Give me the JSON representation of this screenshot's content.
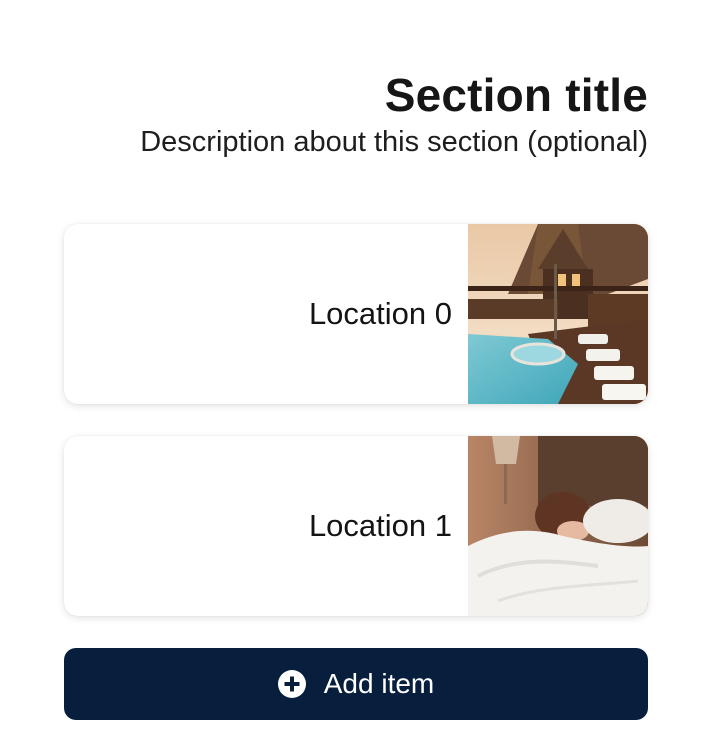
{
  "section": {
    "title": "Section title",
    "description": "Description about this section (optional)"
  },
  "items": [
    {
      "label": "Location 0",
      "image": "resort-pool-photo"
    },
    {
      "label": "Location 1",
      "image": "woman-in-bed-photo"
    }
  ],
  "add_button": {
    "label": "Add item",
    "icon": "plus-circle-icon"
  },
  "colors": {
    "button_background": "#071f3d",
    "button_text": "#ffffff"
  }
}
